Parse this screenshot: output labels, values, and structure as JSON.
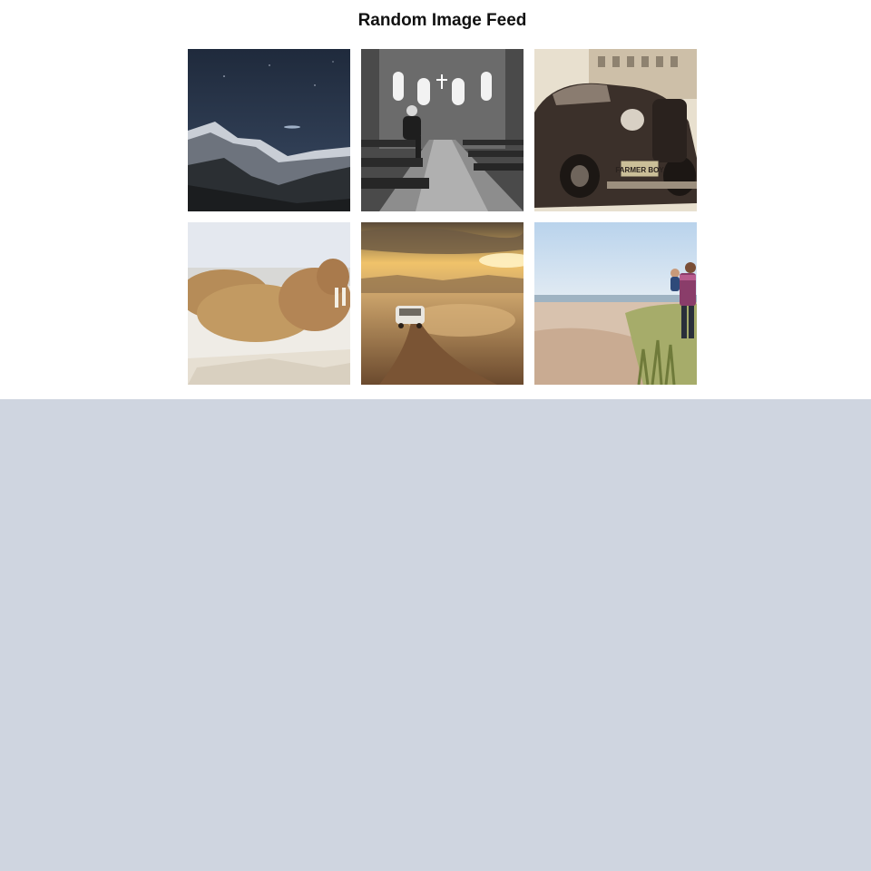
{
  "page": {
    "title": "Random Image Feed",
    "background": "#cfd5e0",
    "panel_background": "#ffffff"
  },
  "images": [
    {
      "subject": "snowy mountains under night sky"
    },
    {
      "subject": "man sitting in church pews, black and white"
    },
    {
      "subject": "vintage car",
      "plate_text": "FARMER BOY"
    },
    {
      "subject": "walruses resting on snow"
    },
    {
      "subject": "car driving on dusty road at sunset"
    },
    {
      "subject": "father carrying child on beach path"
    }
  ]
}
